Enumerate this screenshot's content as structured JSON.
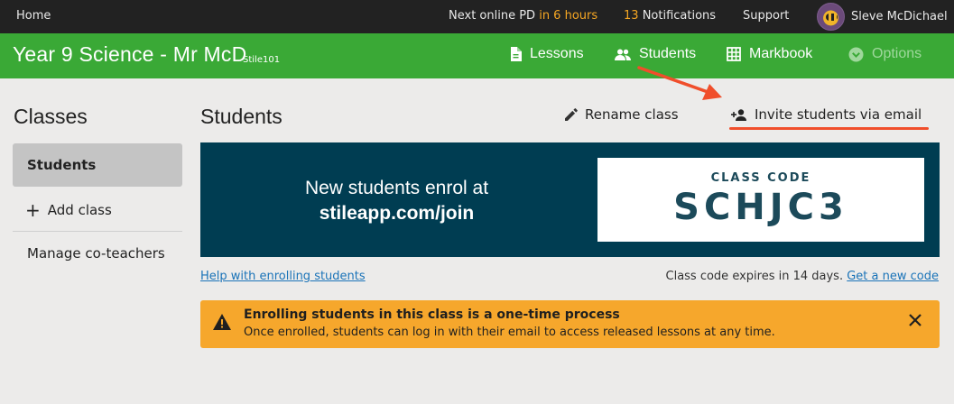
{
  "topbar": {
    "home": "Home",
    "pd_prefix": "Next online PD",
    "pd_time": "in 6 hours",
    "notif_count": "13",
    "notif_label": "Notifications",
    "support": "Support",
    "user_name": "Sleve McDichael"
  },
  "header": {
    "class_title": "Year 9 Science - Mr McD",
    "class_subtitle": "Stile101",
    "nav": {
      "lessons": "Lessons",
      "students": "Students",
      "markbook": "Markbook",
      "options": "Options"
    }
  },
  "sidebar": {
    "title": "Classes",
    "active_item": "Students",
    "add_class": "Add class",
    "manage": "Manage co-teachers"
  },
  "main": {
    "title": "Students",
    "rename": "Rename class",
    "invite": "Invite students via email",
    "enrol_line1": "New students enrol at",
    "enrol_url": "stileapp.com/join",
    "code_label": "CLASS CODE",
    "code": "SCHJC3",
    "help_link": "Help with enrolling students",
    "expires_text": "Class code expires in 14 days.",
    "new_code_link": "Get a new code",
    "alert_heading": "Enrolling students in this class is a one-time process",
    "alert_body": "Once enrolled, students can log in with their email to access released lessons at any time."
  },
  "colors": {
    "header_green": "#3aa936",
    "banner_navy": "#003d52",
    "alert_orange": "#f6a72c",
    "annotation_red": "#f04e2b",
    "link_blue": "#1a73b8"
  },
  "icons": [
    "document-icon",
    "people-icon",
    "grid-icon",
    "chevron-down-circle-icon",
    "pencil-icon",
    "person-add-icon",
    "warning-icon",
    "close-icon",
    "plus-icon",
    "avatar"
  ]
}
